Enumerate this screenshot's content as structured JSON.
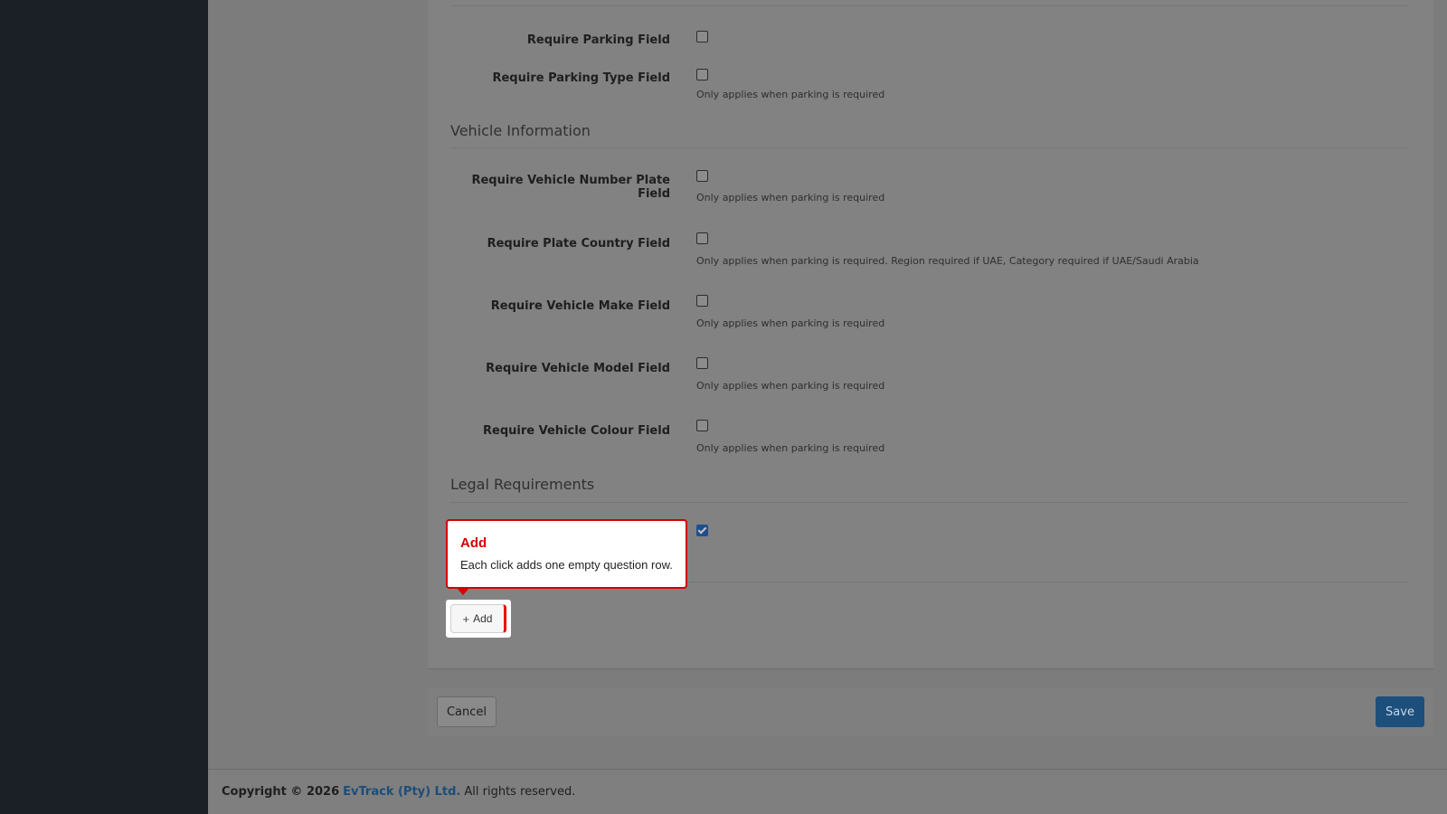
{
  "sections": {
    "vehicle_title": "Vehicle Information",
    "legal_title": "Legal Requirements"
  },
  "fields": {
    "parking": {
      "label": "Require Parking Field",
      "checked": false
    },
    "parking_type": {
      "label": "Require Parking Type Field",
      "help": "Only applies when parking is required",
      "checked": false
    },
    "number_plate": {
      "label": "Require Vehicle Number Plate Field",
      "help": "Only applies when parking is required",
      "checked": false
    },
    "plate_country": {
      "label": "Require Plate Country Field",
      "help": "Only applies when parking is required. Region required if UAE, Category required if UAE/Saudi Arabia",
      "checked": false
    },
    "vehicle_make": {
      "label": "Require Vehicle Make Field",
      "help": "Only applies when parking is required",
      "checked": false
    },
    "vehicle_model": {
      "label": "Require Vehicle Model Field",
      "help": "Only applies when parking is required",
      "checked": false
    },
    "vehicle_colour": {
      "label": "Require Vehicle Colour Field",
      "help": "Only applies when parking is required",
      "checked": false
    },
    "legal": {
      "checked": true
    }
  },
  "tooltip": {
    "title": "Add",
    "body": "Each click adds one empty question row."
  },
  "add_button": {
    "label": "Add",
    "icon": "plus-icon"
  },
  "actions": {
    "cancel_label": "Cancel",
    "save_label": "Save"
  },
  "footer": {
    "copyright": "Copyright © 2026",
    "company": "EvTrack (Pty) Ltd.",
    "rights": "All rights reserved."
  },
  "colors": {
    "accent": "#d40000",
    "save": "#1d4f7c",
    "link": "#1d4c77"
  }
}
